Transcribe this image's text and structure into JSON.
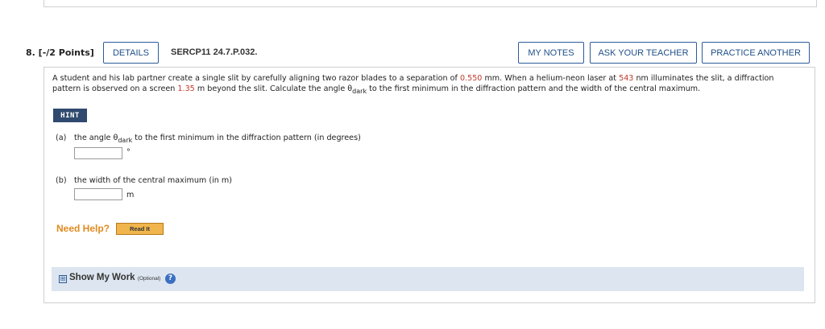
{
  "header": {
    "question_number": "8.  [-/2 Points]",
    "details_label": "DETAILS",
    "code": "SERCP11 24.7.P.032.",
    "my_notes_label": "MY NOTES",
    "ask_teacher_label": "ASK YOUR TEACHER",
    "practice_another_label": "PRACTICE ANOTHER"
  },
  "question": {
    "t1": "A student and his lab partner create a single slit by carefully aligning two razor blades to a separation of ",
    "sep": "0.550",
    "t2": " mm. When a helium-neon laser at ",
    "wave": "543",
    "t3": " nm illuminates the slit, a diffraction pattern is observed on a screen ",
    "dist": "1.35",
    "t4": " m beyond the slit. Calculate the angle θ",
    "sub": "dark",
    "t5": " to the first minimum in the diffraction pattern and the width of the central maximum."
  },
  "hint_label": "HINT",
  "part_a": {
    "label": "(a)",
    "text_pre": "the angle θ",
    "sub": "dark",
    "text_post": " to the first minimum in the diffraction pattern (in degrees)",
    "unit": "°",
    "value": ""
  },
  "part_b": {
    "label": "(b)",
    "text": "the width of the central maximum (in m)",
    "unit": "m",
    "value": ""
  },
  "help": {
    "need_help": "Need Help?",
    "read_it": "Read It"
  },
  "show_work": {
    "label": "Show My Work",
    "optional": "(Optional)",
    "plus": "⊞",
    "help_glyph": "?"
  }
}
